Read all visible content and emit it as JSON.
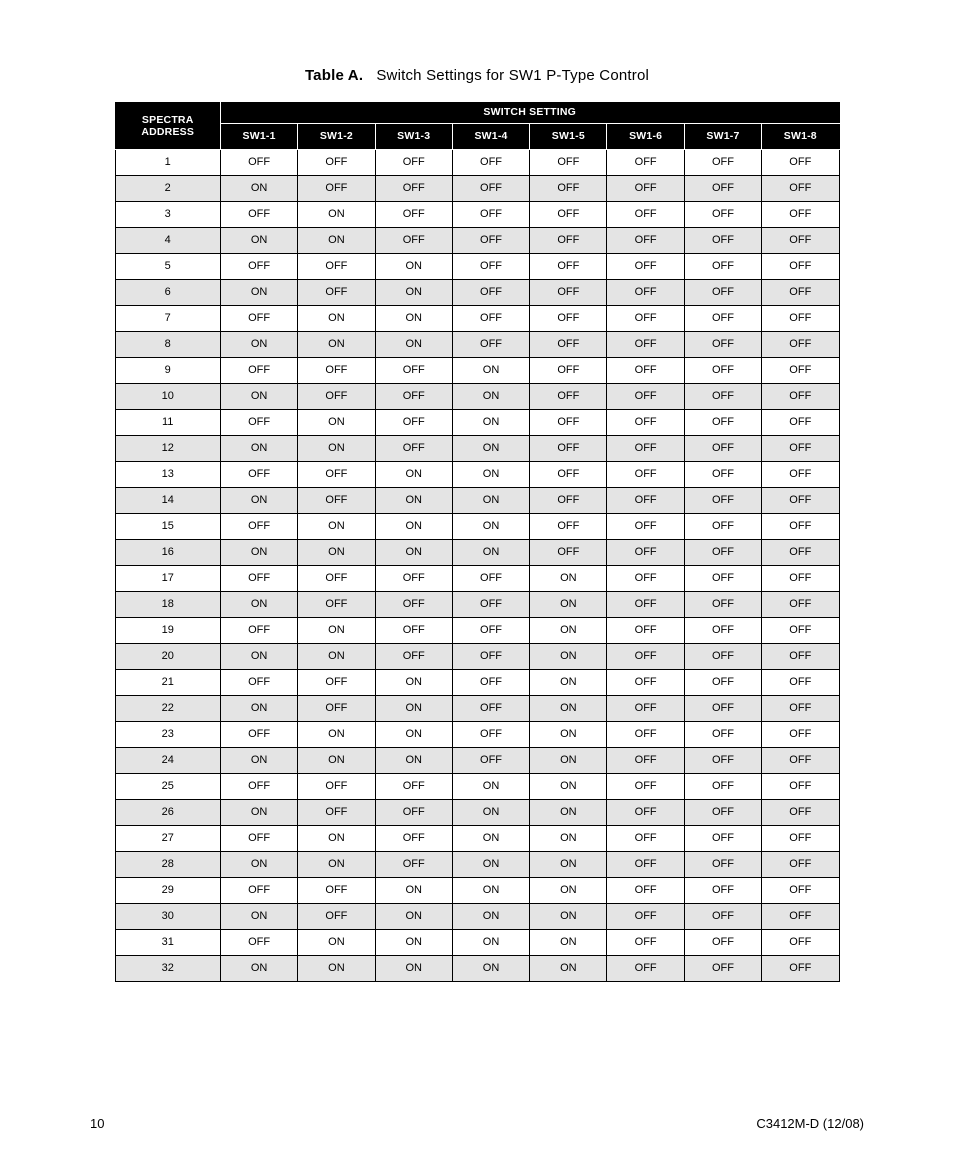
{
  "caption": {
    "label": "Table A.",
    "text": "Switch Settings for SW1 P-Type Control"
  },
  "header": {
    "addr_l1": "SPECTRA",
    "addr_l2": "ADDRESS",
    "group": "SWITCH SETTING",
    "cols": [
      "SW1-1",
      "SW1-2",
      "SW1-3",
      "SW1-4",
      "SW1-5",
      "SW1-6",
      "SW1-7",
      "SW1-8"
    ]
  },
  "rows": [
    {
      "addr": "1",
      "v": [
        "OFF",
        "OFF",
        "OFF",
        "OFF",
        "OFF",
        "OFF",
        "OFF",
        "OFF"
      ]
    },
    {
      "addr": "2",
      "v": [
        "ON",
        "OFF",
        "OFF",
        "OFF",
        "OFF",
        "OFF",
        "OFF",
        "OFF"
      ]
    },
    {
      "addr": "3",
      "v": [
        "OFF",
        "ON",
        "OFF",
        "OFF",
        "OFF",
        "OFF",
        "OFF",
        "OFF"
      ]
    },
    {
      "addr": "4",
      "v": [
        "ON",
        "ON",
        "OFF",
        "OFF",
        "OFF",
        "OFF",
        "OFF",
        "OFF"
      ]
    },
    {
      "addr": "5",
      "v": [
        "OFF",
        "OFF",
        "ON",
        "OFF",
        "OFF",
        "OFF",
        "OFF",
        "OFF"
      ]
    },
    {
      "addr": "6",
      "v": [
        "ON",
        "OFF",
        "ON",
        "OFF",
        "OFF",
        "OFF",
        "OFF",
        "OFF"
      ]
    },
    {
      "addr": "7",
      "v": [
        "OFF",
        "ON",
        "ON",
        "OFF",
        "OFF",
        "OFF",
        "OFF",
        "OFF"
      ]
    },
    {
      "addr": "8",
      "v": [
        "ON",
        "ON",
        "ON",
        "OFF",
        "OFF",
        "OFF",
        "OFF",
        "OFF"
      ]
    },
    {
      "addr": "9",
      "v": [
        "OFF",
        "OFF",
        "OFF",
        "ON",
        "OFF",
        "OFF",
        "OFF",
        "OFF"
      ]
    },
    {
      "addr": "10",
      "v": [
        "ON",
        "OFF",
        "OFF",
        "ON",
        "OFF",
        "OFF",
        "OFF",
        "OFF"
      ]
    },
    {
      "addr": "11",
      "v": [
        "OFF",
        "ON",
        "OFF",
        "ON",
        "OFF",
        "OFF",
        "OFF",
        "OFF"
      ]
    },
    {
      "addr": "12",
      "v": [
        "ON",
        "ON",
        "OFF",
        "ON",
        "OFF",
        "OFF",
        "OFF",
        "OFF"
      ]
    },
    {
      "addr": "13",
      "v": [
        "OFF",
        "OFF",
        "ON",
        "ON",
        "OFF",
        "OFF",
        "OFF",
        "OFF"
      ]
    },
    {
      "addr": "14",
      "v": [
        "ON",
        "OFF",
        "ON",
        "ON",
        "OFF",
        "OFF",
        "OFF",
        "OFF"
      ]
    },
    {
      "addr": "15",
      "v": [
        "OFF",
        "ON",
        "ON",
        "ON",
        "OFF",
        "OFF",
        "OFF",
        "OFF"
      ]
    },
    {
      "addr": "16",
      "v": [
        "ON",
        "ON",
        "ON",
        "ON",
        "OFF",
        "OFF",
        "OFF",
        "OFF"
      ]
    },
    {
      "addr": "17",
      "v": [
        "OFF",
        "OFF",
        "OFF",
        "OFF",
        "ON",
        "OFF",
        "OFF",
        "OFF"
      ]
    },
    {
      "addr": "18",
      "v": [
        "ON",
        "OFF",
        "OFF",
        "OFF",
        "ON",
        "OFF",
        "OFF",
        "OFF"
      ]
    },
    {
      "addr": "19",
      "v": [
        "OFF",
        "ON",
        "OFF",
        "OFF",
        "ON",
        "OFF",
        "OFF",
        "OFF"
      ]
    },
    {
      "addr": "20",
      "v": [
        "ON",
        "ON",
        "OFF",
        "OFF",
        "ON",
        "OFF",
        "OFF",
        "OFF"
      ]
    },
    {
      "addr": "21",
      "v": [
        "OFF",
        "OFF",
        "ON",
        "OFF",
        "ON",
        "OFF",
        "OFF",
        "OFF"
      ]
    },
    {
      "addr": "22",
      "v": [
        "ON",
        "OFF",
        "ON",
        "OFF",
        "ON",
        "OFF",
        "OFF",
        "OFF"
      ]
    },
    {
      "addr": "23",
      "v": [
        "OFF",
        "ON",
        "ON",
        "OFF",
        "ON",
        "OFF",
        "OFF",
        "OFF"
      ]
    },
    {
      "addr": "24",
      "v": [
        "ON",
        "ON",
        "ON",
        "OFF",
        "ON",
        "OFF",
        "OFF",
        "OFF"
      ]
    },
    {
      "addr": "25",
      "v": [
        "OFF",
        "OFF",
        "OFF",
        "ON",
        "ON",
        "OFF",
        "OFF",
        "OFF"
      ]
    },
    {
      "addr": "26",
      "v": [
        "ON",
        "OFF",
        "OFF",
        "ON",
        "ON",
        "OFF",
        "OFF",
        "OFF"
      ]
    },
    {
      "addr": "27",
      "v": [
        "OFF",
        "ON",
        "OFF",
        "ON",
        "ON",
        "OFF",
        "OFF",
        "OFF"
      ]
    },
    {
      "addr": "28",
      "v": [
        "ON",
        "ON",
        "OFF",
        "ON",
        "ON",
        "OFF",
        "OFF",
        "OFF"
      ]
    },
    {
      "addr": "29",
      "v": [
        "OFF",
        "OFF",
        "ON",
        "ON",
        "ON",
        "OFF",
        "OFF",
        "OFF"
      ]
    },
    {
      "addr": "30",
      "v": [
        "ON",
        "OFF",
        "ON",
        "ON",
        "ON",
        "OFF",
        "OFF",
        "OFF"
      ]
    },
    {
      "addr": "31",
      "v": [
        "OFF",
        "ON",
        "ON",
        "ON",
        "ON",
        "OFF",
        "OFF",
        "OFF"
      ]
    },
    {
      "addr": "32",
      "v": [
        "ON",
        "ON",
        "ON",
        "ON",
        "ON",
        "OFF",
        "OFF",
        "OFF"
      ]
    }
  ],
  "footer": {
    "page": "10",
    "doc": "C3412M-D (12/08)"
  }
}
